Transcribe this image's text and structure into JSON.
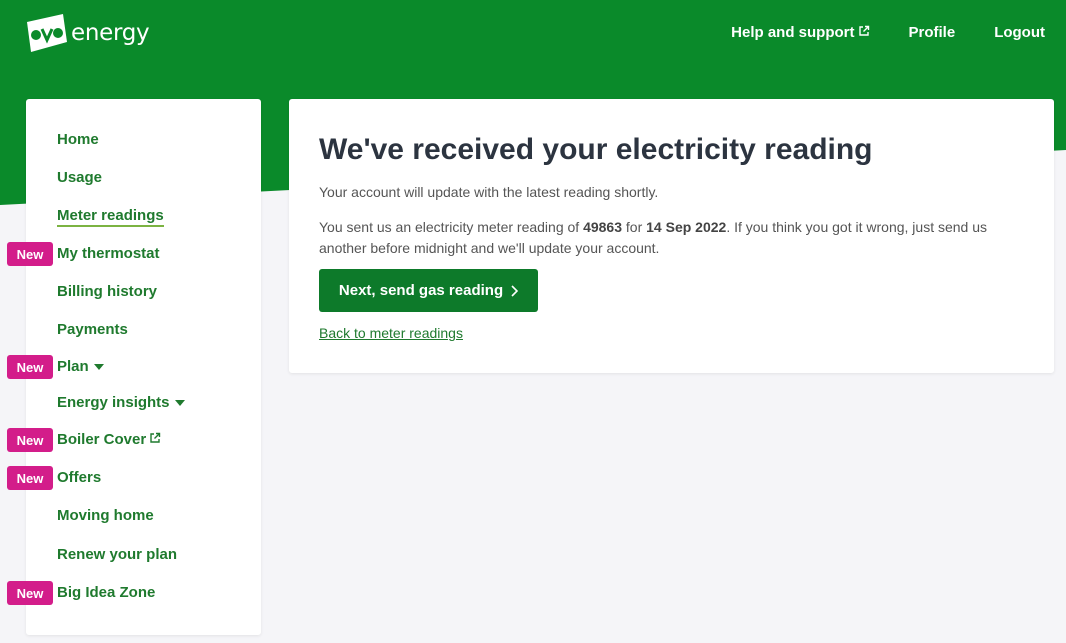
{
  "brand": {
    "logo_text": "energy",
    "accent": "#0a8a2a",
    "badge_color": "#d31d8a"
  },
  "topnav": {
    "help_label": "Help and support",
    "profile_label": "Profile",
    "logout_label": "Logout"
  },
  "sidebar": {
    "items": [
      {
        "label": "Home"
      },
      {
        "label": "Usage"
      },
      {
        "label": "Meter readings",
        "active": true
      },
      {
        "label": "My thermostat",
        "badge": "New"
      },
      {
        "label": "Billing history"
      },
      {
        "label": "Payments"
      },
      {
        "label": "Plan",
        "badge": "New",
        "dropdown": true
      },
      {
        "label": "Energy insights",
        "dropdown": true
      },
      {
        "label": "Boiler Cover",
        "badge": "New",
        "external": true
      },
      {
        "label": "Offers",
        "badge": "New"
      },
      {
        "label": "Moving home"
      },
      {
        "label": "Renew your plan"
      },
      {
        "label": "Big Idea Zone",
        "badge": "New"
      }
    ]
  },
  "main": {
    "title": "We've received your electricity reading",
    "update_text": "Your account will update with the latest reading shortly.",
    "sent_prefix": "You sent us an electricity meter reading of ",
    "reading": "49863",
    "sent_mid": " for ",
    "date": "14 Sep 2022",
    "sent_suffix": ". If you think you got it wrong, just send us another before midnight and we'll update your account.",
    "next_button": "Next, send gas reading",
    "back_link": "Back to meter readings"
  }
}
